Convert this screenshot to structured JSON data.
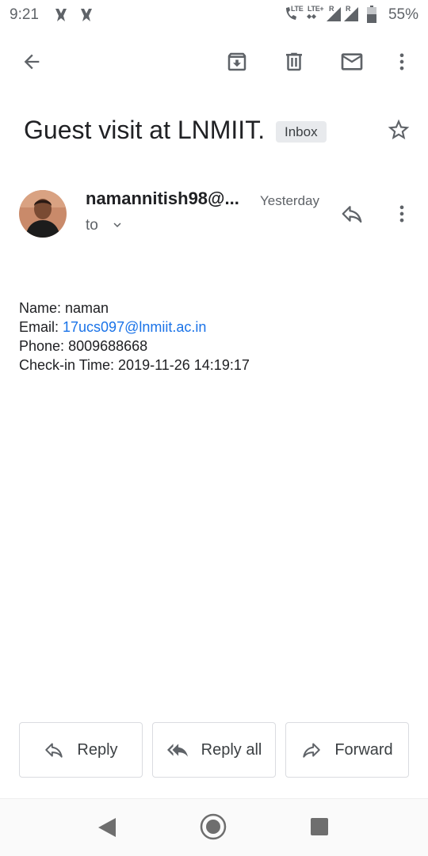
{
  "status_bar": {
    "time": "9:21",
    "network_label_1": "LTE",
    "network_label_2": "LTE+",
    "roaming_1": "R",
    "roaming_2": "R",
    "battery_percent": "55%"
  },
  "icons": {
    "back": "arrow-left-icon",
    "archive": "archive-icon",
    "delete": "trash-icon",
    "mark_unread": "mail-icon",
    "more": "more-vertical-icon",
    "star": "star-icon",
    "reply": "reply-icon",
    "reply_all": "reply-all-icon",
    "forward": "forward-icon"
  },
  "email": {
    "subject": "Guest visit at LNMIIT.",
    "label": "Inbox",
    "sender": "namannitish98@...",
    "date": "Yesterday",
    "to_label": "to",
    "body": {
      "name_label": "Name: ",
      "name_value": "naman",
      "email_label": "Email: ",
      "email_value": "17ucs097@lnmiit.ac.in",
      "phone_label": "Phone: ",
      "phone_value": "8009688668",
      "checkin_label": "Check-in Time: ",
      "checkin_value": "2019-11-26 14:19:17"
    }
  },
  "actions": {
    "reply": "Reply",
    "reply_all": "Reply all",
    "forward": "Forward"
  },
  "colors": {
    "accent_link": "#1a73e8",
    "icon_gray": "#5f6368",
    "text": "#202124"
  }
}
